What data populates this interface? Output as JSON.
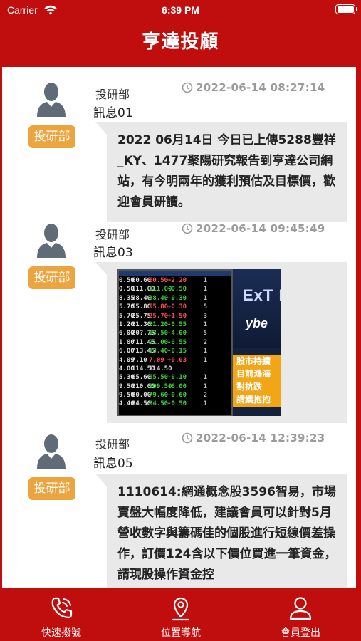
{
  "status_bar": {
    "carrier": "Carrier",
    "time": "6:39 PM",
    "wifi_icon": "wifi-icon",
    "battery_icon": "battery-icon"
  },
  "header": {
    "title": "亨達投顧",
    "background_color": "#c00d0d"
  },
  "messages": [
    {
      "sender": "投研部",
      "badge": "投研部",
      "title": "訊息01",
      "time": "2022-06-14 08:27:14",
      "body": "2022 06月14日 今日已上傳5288豐祥_KY、1477聚陽研究報告到亨達公司網站，有今明兩年的獲利預估及目標價，歡迎會員研讀。"
    },
    {
      "sender": "投研部",
      "badge": "投研部",
      "title": "訊息03",
      "time": "2022-06-14 09:45:49",
      "image": {
        "ad_lines": [
          "股市持續",
          "目前鴻海",
          "對抗跌",
          "請續抱抱"
        ]
      }
    },
    {
      "sender": "投研部",
      "badge": "投研部",
      "title": "訊息05",
      "time": "2022-06-14 12:39:23",
      "body": "1110614:網通概念股3596智易，市場賣盤大幅度降低，建議會員可以針對5月營收數字與籌碼佳的個股進行短線價差操作，訂價124含以下價位買進一筆資金，請現股操作資金控"
    }
  ],
  "tabbar": {
    "items": [
      {
        "label": "快速撥號",
        "icon": "phone-icon"
      },
      {
        "label": "位置導航",
        "icon": "map-pin-icon"
      },
      {
        "label": "會員登出",
        "icon": "user-icon"
      }
    ]
  },
  "colors": {
    "accent": "#c00d0d",
    "badge": "#eba43e",
    "bubble": "#e9e9e9",
    "timestamp": "#9a9a9a"
  }
}
